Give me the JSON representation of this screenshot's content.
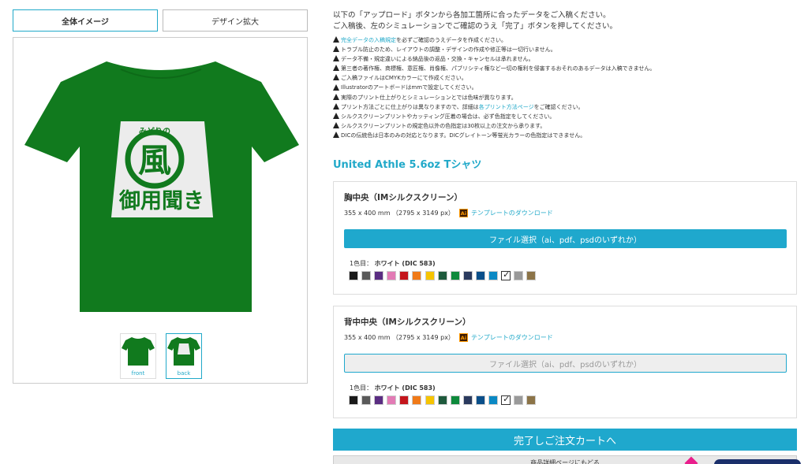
{
  "tabs": {
    "overall": "全体イメージ",
    "zoom": "デザイン拡大"
  },
  "preview": {
    "design_text_small": "みどりの",
    "design_text_char": "風",
    "design_text_main": "御用聞き",
    "thumbs": [
      {
        "label": "front"
      },
      {
        "label": "back"
      }
    ],
    "shirt_color": "#117a1e",
    "print_color": "#ececec"
  },
  "intro": {
    "line1": "以下の「アップロード」ボタンから各加工箇所に合ったデータをご入稿ください。",
    "line2": "ご入稿後、左のシミュレーションでご確認のうえ「完了」ボタンを押してください。"
  },
  "notices": {
    "n1_link": "完全データの入稿規定",
    "n1_rest": "を必ずご確認のうえデータを作成ください。",
    "n2": "トラブル防止のため、レイアウトの調整・デザインの作成や修正等は一切行いません。",
    "n3": "データ不備・規定違いによる納品後の返品・交換・キャンセルは承れません。",
    "n4": "第三者の著作権、商標権、意匠権、肖像権、パブリシティ権など一切の権利を侵害するおそれのあるデータは入稿できません。",
    "n5": "ご入稿ファイルはCMYKカラーにて作成ください。",
    "n6": "Illustratorのアートボードはmmで設定してください。",
    "n7": "実際のプリント仕上がりとシミュレーションとでは色味が異なります。",
    "n8_pre": "プリント方法ごとに仕上がりは異なりますので、詳細は",
    "n8_link": "各プリント方法ページ",
    "n8_post": "をご確認ください。",
    "n9": "シルクスクリーンプリントやカッティング圧着の場合は、必ず色指定をしてください。",
    "n10": "シルクスクリーンプリントの規定色以外の色指定は30枚以上の注文から承ります。",
    "n11": "DICの伝統色は日本のみの対応となります。DICグレイトーン等蛍光カラーの色指定はできません。"
  },
  "product_title": "United Athle 5.6oz Tシャツ",
  "panels": {
    "chest": {
      "title": "胸中央（IMシルクスクリーン）",
      "dims": "355 x 400 mm （2795 x 3149 px）",
      "ai": "Ai",
      "template_link": "テンプレートのダウンロード",
      "file_button": "ファイル選択（ai、pdf、psdのいずれか）",
      "color_prefix": "1色目：",
      "color_name": "ホワイト (DIC 583)"
    },
    "back": {
      "title": "背中中央（IMシルクスクリーン）",
      "dims": "355 x 400 mm （2795 x 3149 px）",
      "ai": "Ai",
      "template_link": "テンプレートのダウンロード",
      "file_button": "ファイル選択（ai、pdf、psdのいずれか）",
      "color_prefix": "1色目：",
      "color_name": "ホワイト (DIC 583)"
    }
  },
  "swatch_colors": [
    "#1a1a1a",
    "#5a5a5a",
    "#5a2d82",
    "#e27bb5",
    "#c4161c",
    "#f07a18",
    "#f6c400",
    "#1e5a3c",
    "#0e8a3c",
    "#2a3a5e",
    "#0a4f8a",
    "#0a89c4",
    "#ffffff",
    "#9a9a9a",
    "#8c7448"
  ],
  "selected_swatch": 12,
  "buttons": {
    "cart": "完了しご注文カートへ",
    "back_to_product": "商品詳細ページにもどる"
  }
}
